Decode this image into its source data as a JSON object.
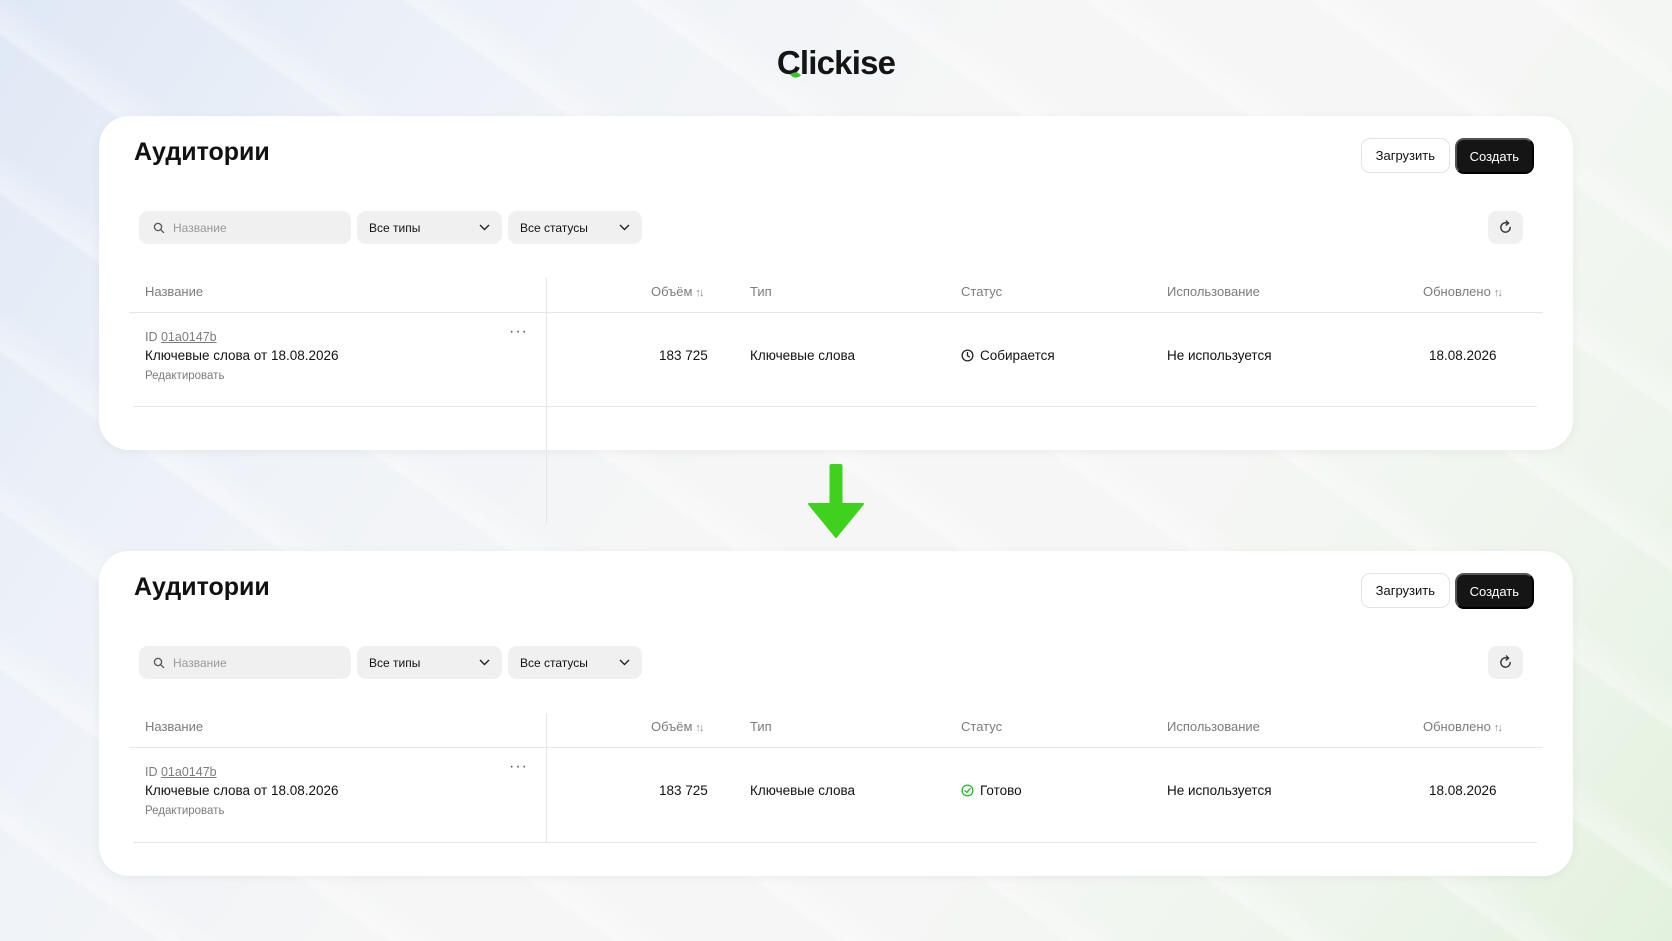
{
  "brand": {
    "logo_text_first": "C",
    "logo_text_rest": "lickise",
    "accent_color": "#3cc12a"
  },
  "arrow_color": "#3ed21f",
  "panels": [
    {
      "title": "Аудитории",
      "upload_label": "Загрузить",
      "create_label": "Создать",
      "search_placeholder": "Название",
      "type_filter": "Все типы",
      "status_filter": "Все статусы",
      "columns": {
        "name": "Название",
        "volume": "Объём",
        "type": "Тип",
        "status": "Статус",
        "usage": "Использование",
        "updated": "Обновлено"
      },
      "row": {
        "id_prefix": "ID",
        "id": "01a0147b",
        "name": "Ключевые слова от 18.08.2026",
        "edit": "Редактировать",
        "more": "···",
        "volume": "183 725",
        "type": "Ключевые слова",
        "status": "Собирается",
        "status_icon": "clock-icon",
        "usage": "Не используется",
        "updated": "18.08.2026"
      }
    },
    {
      "title": "Аудитории",
      "upload_label": "Загрузить",
      "create_label": "Создать",
      "search_placeholder": "Название",
      "type_filter": "Все типы",
      "status_filter": "Все статусы",
      "columns": {
        "name": "Название",
        "volume": "Объём",
        "type": "Тип",
        "status": "Статус",
        "usage": "Использование",
        "updated": "Обновлено"
      },
      "row": {
        "id_prefix": "ID",
        "id": "01a0147b",
        "name": "Ключевые слова от 18.08.2026",
        "edit": "Редактировать",
        "more": "···",
        "volume": "183 725",
        "type": "Ключевые слова",
        "status": "Готово",
        "status_icon": "check-circle-icon",
        "status_color": "#2bb52b",
        "usage": "Не используется",
        "updated": "18.08.2026"
      }
    }
  ]
}
